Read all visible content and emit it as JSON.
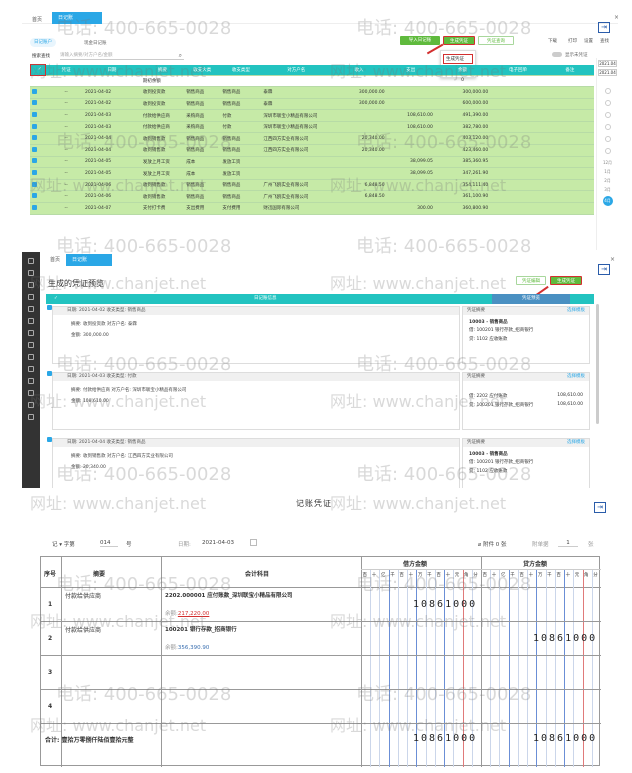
{
  "watermarks": {
    "phone": "电话: 400-665-0028",
    "web": "网址: www.chanjet.net"
  },
  "section1": {
    "tabs": [
      "首页",
      "日记账"
    ],
    "close_glyph": "×",
    "subtab": {
      "active": "日记账户",
      "other": "现金日记账"
    },
    "buttons": [
      "导入日记账",
      "生成凭证",
      "凭证查询",
      "下载",
      "打印",
      "设置",
      "查找"
    ],
    "dropdown": [
      "生成凭证",
      "凭证配置"
    ],
    "filter_label": "搜索查找",
    "search_placeholder": "请输入摘要/对方户名/金额",
    "date_range_label": "显示未凭证",
    "headers": [
      "",
      "凭证",
      "日期",
      "摘要",
      "收支大类",
      "收支类型",
      "对方户名",
      "收入",
      "支出",
      "余额",
      "电子回单",
      "备注"
    ],
    "opening": {
      "label": "期初余额",
      "balance": "0"
    },
    "rows": [
      {
        "voucher": "--",
        "date": "2021-04-02",
        "summary": "收到投资款",
        "cat": "销售商品",
        "type": "销售商品",
        "party": "泰霖",
        "income": "300,000.00",
        "expense": "",
        "balance": "300,000.00"
      },
      {
        "voucher": "--",
        "date": "2021-04-02",
        "summary": "收到投资款",
        "cat": "销售商品",
        "type": "销售商品",
        "party": "泰霖",
        "income": "300,000.00",
        "expense": "",
        "balance": "600,000.00"
      },
      {
        "voucher": "--",
        "date": "2021-04-03",
        "summary": "付款给供应商",
        "cat": "采购商品",
        "type": "付款",
        "party": "深圳市联宝小精品有限公司",
        "income": "",
        "expense": "108,610.00",
        "balance": "491,390.00"
      },
      {
        "voucher": "--",
        "date": "2021-04-03",
        "summary": "付款给供应商",
        "cat": "采购商品",
        "type": "付款",
        "party": "深圳市联宝小精品有限公司",
        "income": "",
        "expense": "108,610.00",
        "balance": "382,780.00"
      },
      {
        "voucher": "--",
        "date": "2021-04-04",
        "summary": "收到销售款",
        "cat": "销售商品",
        "type": "销售商品",
        "party": "江西四方实业有限公司",
        "income": "20,340.00",
        "expense": "",
        "balance": "403,120.00"
      },
      {
        "voucher": "--",
        "date": "2021-04-04",
        "summary": "收到销售款",
        "cat": "销售商品",
        "type": "销售商品",
        "party": "江西四方实业有限公司",
        "income": "20,340.00",
        "expense": "",
        "balance": "423,460.00"
      },
      {
        "voucher": "--",
        "date": "2021-04-05",
        "summary": "发放上月工资",
        "cat": "成本",
        "type": "发放工资",
        "party": "",
        "income": "",
        "expense": "38,099.05",
        "balance": "385,360.95"
      },
      {
        "voucher": "--",
        "date": "2021-04-05",
        "summary": "发放上月工资",
        "cat": "成本",
        "type": "发放工资",
        "party": "",
        "income": "",
        "expense": "38,099.05",
        "balance": "347,261.90"
      },
      {
        "voucher": "--",
        "date": "2021-04-06",
        "summary": "收到销售款",
        "cat": "销售商品",
        "type": "销售商品",
        "party": "广州飞鸥实业有限公司",
        "income": "6,848.50",
        "expense": "",
        "balance": "354,111.40"
      },
      {
        "voucher": "--",
        "date": "2021-04-06",
        "summary": "收到销售款",
        "cat": "销售商品",
        "type": "销售商品",
        "party": "广州飞鸥实业有限公司",
        "income": "6,848.50",
        "expense": "",
        "balance": "361,100.90"
      },
      {
        "voucher": "--",
        "date": "2021-04-07",
        "summary": "支付打卡费",
        "cat": "支出费用",
        "type": "支付费用",
        "party": "财迅国际有限公司",
        "income": "",
        "expense": "300.00",
        "balance": "360,800.90"
      }
    ],
    "right_panel": {
      "dates": [
        "2021.04",
        "2021.04"
      ],
      "months": [
        "12月",
        "1月",
        "2月",
        "3月",
        "4月"
      ],
      "active_month": "4月"
    }
  },
  "section2": {
    "tabs": [
      "首页",
      "日记账"
    ],
    "title": "生成的凭证预览",
    "buttons": [
      "凭证编辑",
      "生成凭证"
    ],
    "col_left": "日记账信息",
    "col_right": "凭证预览",
    "cards": [
      {
        "head": "日期: 2021-04-02    收支类型: 销售商品",
        "l1": "摘要: 收到投资款      对方户名: 泰霖",
        "l2": "金额: 300,000.00",
        "vhead": "凭证摘要",
        "vlink": "选择模板",
        "v1": "10003 - 销售商品",
        "v2": "借: 100201 银行存款_招商银行",
        "v3": "贷: 1102 应收账款",
        "amt1": "",
        "amt2": ""
      },
      {
        "head": "日期: 2021-04-03    收支类型: 付款",
        "l1": "摘要: 付款给供应商      对方户名: 深圳市联宝小精品有限公司",
        "l2": "金额: 108,610.00",
        "vhead": "凭证摘要",
        "vlink": "选择模板",
        "v1": "",
        "v2": "借: 2202 应付账款",
        "v3": "贷: 100201 银行存款_招商银行",
        "amt1": "108,610.00",
        "amt2": "108,610.00"
      },
      {
        "head": "日期: 2021-04-04    收支类型: 销售商品",
        "l1": "摘要: 收到销售款      对方户名: 江西四方实业有限公司",
        "l2": "金额: 20,340.00",
        "vhead": "凭证摘要",
        "vlink": "选择模板",
        "v1": "10003 - 销售商品",
        "v2": "借: 100201 银行存款_招商银行",
        "v3": "贷: 1102 应收账款",
        "amt1": "",
        "amt2": ""
      }
    ]
  },
  "section3": {
    "title": "记账凭证",
    "word_label": "记",
    "word_num": "字第",
    "number": "014",
    "hao": "号",
    "date_label": "日期:",
    "date": "2021-04-03",
    "attach": "附件 0 张",
    "attach_count_label": "附单据",
    "attach_count": "1",
    "zhang": "张",
    "headers": {
      "seq": "序号",
      "summary": "摘要",
      "account": "会计科目",
      "debit": "借方金额",
      "credit": "贷方金额"
    },
    "digit_units": [
      "百",
      "十",
      "亿",
      "千",
      "百",
      "十",
      "万",
      "千",
      "百",
      "十",
      "元",
      "角",
      "分"
    ],
    "lines": [
      {
        "seq": "1",
        "summary": "付款给供应商",
        "account": "2202.000001 应付账款_深圳联宝小精品有限公司",
        "bal_label": "余额:",
        "bal": "217,220.00",
        "debit": "10861000",
        "credit": ""
      },
      {
        "seq": "2",
        "summary": "付款给供应商",
        "account": "100201 银行存款_招商银行",
        "bal_label": "余额:",
        "bal": "356,390.90",
        "debit": "",
        "credit": "10861000"
      },
      {
        "seq": "3",
        "summary": "",
        "account": "",
        "bal_label": "",
        "bal": "",
        "debit": "",
        "credit": ""
      },
      {
        "seq": "4",
        "summary": "",
        "account": "",
        "bal_label": "",
        "bal": "",
        "debit": "",
        "credit": ""
      }
    ],
    "total_label": "合计:",
    "total_text": "壹拾万零捌仟陆佰壹拾元整",
    "total_debit": "10861000",
    "total_credit": "10861000"
  }
}
